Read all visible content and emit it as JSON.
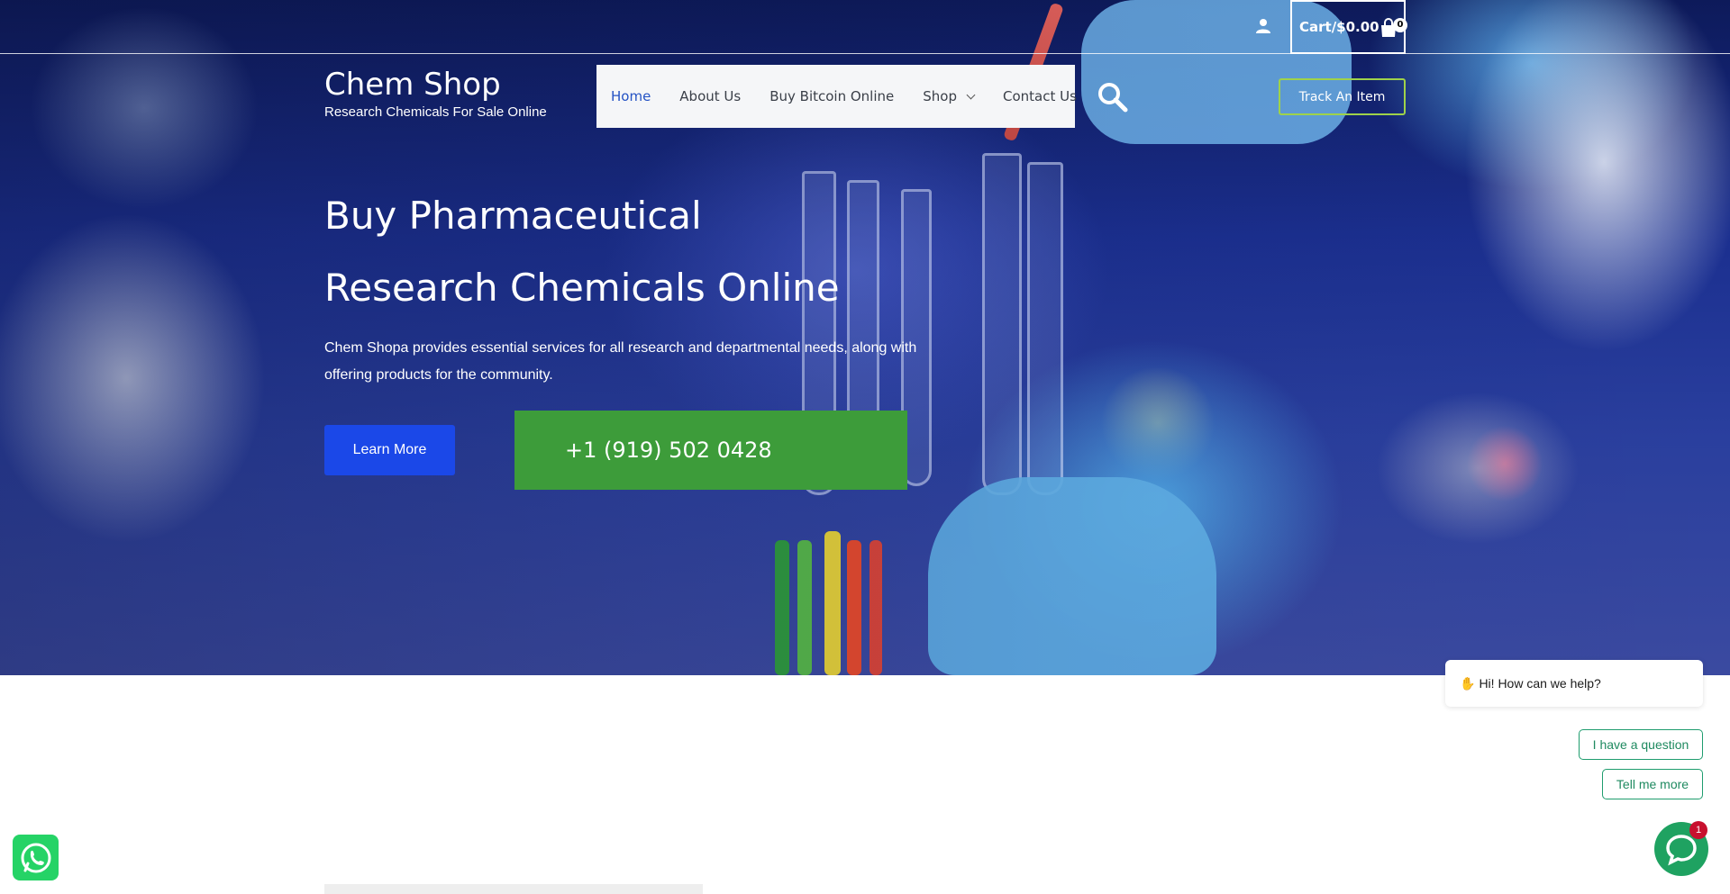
{
  "header": {
    "cart_label": "Cart/$0.00",
    "cart_count": "0",
    "brand_title": "Chem Shop",
    "brand_tagline": "Research Chemicals For Sale Online",
    "nav": [
      {
        "label": "Home"
      },
      {
        "label": "About Us"
      },
      {
        "label": "Buy Bitcoin Online"
      },
      {
        "label": "Shop"
      },
      {
        "label": "Contact Us"
      }
    ],
    "track_label": "Track An Item"
  },
  "hero": {
    "title_line1": "Buy Pharmaceutical",
    "title_line2": "Research Chemicals Online",
    "description": "Chem Shopa provides essential services for all research and departmental needs, along with offering products for the community.",
    "learn_more": "Learn More",
    "phone": "+1 (919) 502 0428"
  },
  "chat": {
    "greeting": "Hi! How can we help?",
    "option1": "I have a question",
    "option2": "Tell me more",
    "badge": "1"
  },
  "colors": {
    "nav_active": "#2452c4",
    "learn_btn": "#1b48e8",
    "phone_btn": "#3d9c3a",
    "track_border": "#9fd24a",
    "chat_green": "#1fa261",
    "whatsapp": "#25d366"
  }
}
